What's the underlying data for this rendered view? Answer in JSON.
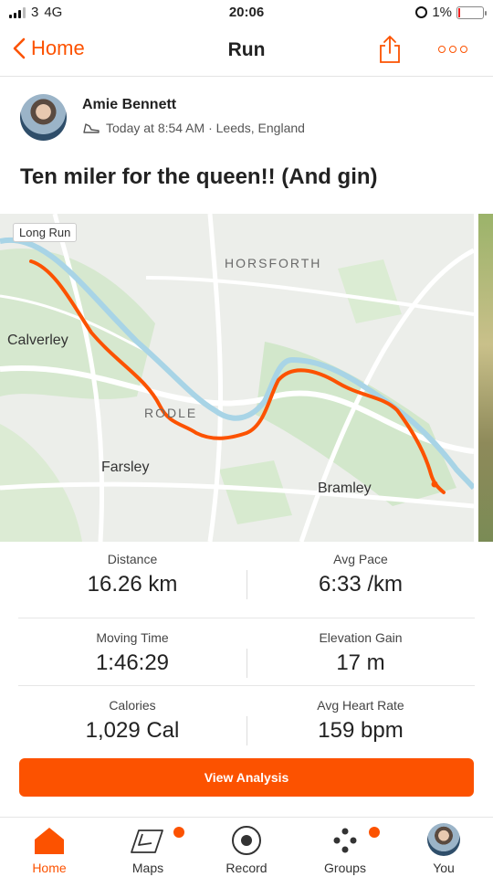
{
  "status_bar": {
    "carrier": "3",
    "network": "4G",
    "time": "20:06",
    "battery": "1%"
  },
  "nav": {
    "back_label": "Home",
    "title": "Run",
    "share_icon": "share-icon",
    "more_icon": "more-icon"
  },
  "activity": {
    "athlete_name": "Amie Bennett",
    "timestamp": "Today at 8:54 AM · Leeds, England",
    "title": "Ten miler for the queen!! (And gin)"
  },
  "map": {
    "badge": "Long Run",
    "places": {
      "horsforth": "HORSFORTH",
      "calverley": "Calverley",
      "rodley": "RODLE",
      "farsley": "Farsley",
      "bramley": "Bramley"
    },
    "route_color": "#fc5200"
  },
  "stats": [
    {
      "label": "Distance",
      "value": "16.26 km"
    },
    {
      "label": "Avg Pace",
      "value": "6:33 /km"
    },
    {
      "label": "Moving Time",
      "value": "1:46:29"
    },
    {
      "label": "Elevation Gain",
      "value": "17 m"
    },
    {
      "label": "Calories",
      "value": "1,029 Cal"
    },
    {
      "label": "Avg Heart Rate",
      "value": "159 bpm"
    }
  ],
  "analysis_button": "View Analysis",
  "tabs": [
    {
      "label": "Home",
      "icon": "home-icon",
      "active": true
    },
    {
      "label": "Maps",
      "icon": "maps-icon",
      "active": false
    },
    {
      "label": "Record",
      "icon": "record-icon",
      "active": false
    },
    {
      "label": "Groups",
      "icon": "groups-icon",
      "active": false
    },
    {
      "label": "You",
      "icon": "avatar",
      "active": false
    }
  ],
  "colors": {
    "accent": "#fc5200"
  }
}
